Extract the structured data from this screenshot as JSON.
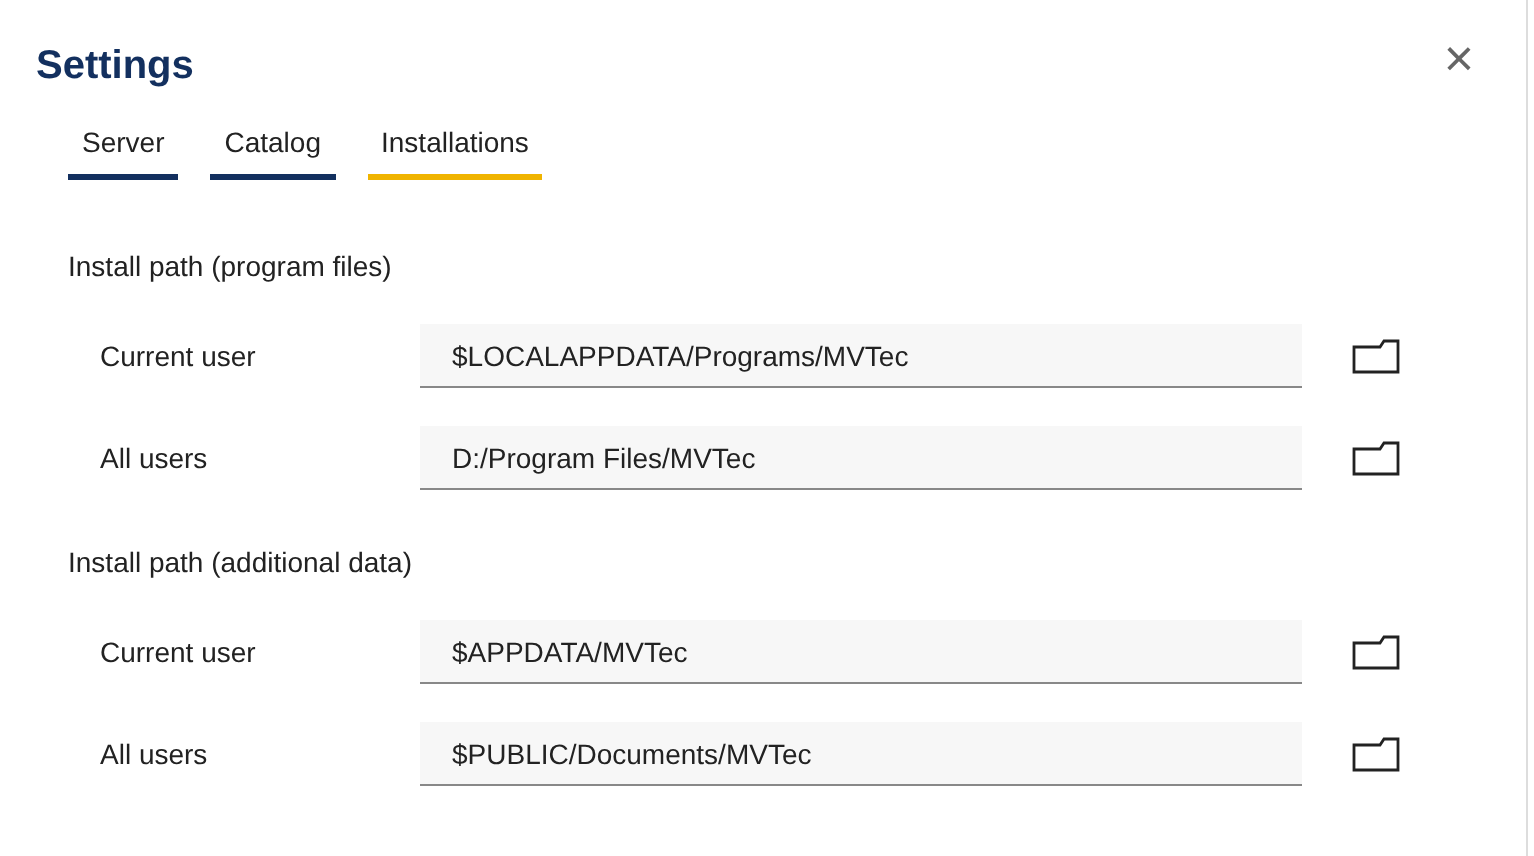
{
  "window": {
    "title": "Settings",
    "close": "×"
  },
  "tabs": [
    {
      "label": "Server",
      "selected": false
    },
    {
      "label": "Catalog",
      "selected": false
    },
    {
      "label": "Installations",
      "selected": true
    }
  ],
  "sections": [
    {
      "heading": "Install path (program files)",
      "rows": [
        {
          "label": "Current user",
          "value": "$LOCALAPPDATA/Programs/MVTec"
        },
        {
          "label": "All users",
          "value": "D:/Program Files/MVTec"
        }
      ]
    },
    {
      "heading": "Install path (additional data)",
      "rows": [
        {
          "label": "Current user",
          "value": "$APPDATA/MVTec"
        },
        {
          "label": "All users",
          "value": "$PUBLIC/Documents/MVTec"
        }
      ]
    }
  ]
}
